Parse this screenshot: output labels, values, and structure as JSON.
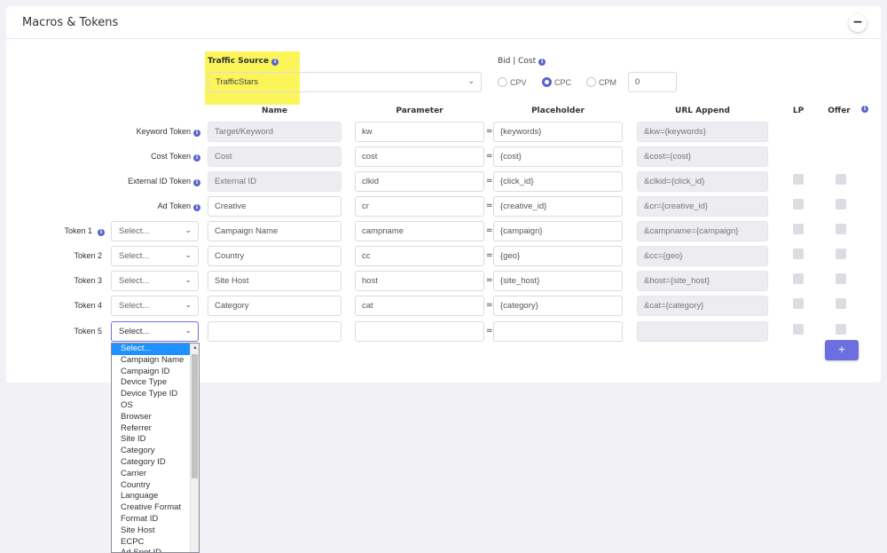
{
  "panel": {
    "title": "Macros & Tokens",
    "collapse_label": "−"
  },
  "traffic_source": {
    "label": "Traffic Source",
    "value": "TrafficStars"
  },
  "bid": {
    "label": "Bid | Cost",
    "options": [
      "CPV",
      "CPC",
      "CPM"
    ],
    "selected": "CPC",
    "amount": "0"
  },
  "columns": {
    "name": "Name",
    "parameter": "Parameter",
    "placeholder": "Placeholder",
    "url_append": "URL Append",
    "lp": "LP",
    "offer": "Offer"
  },
  "fixed_rows": [
    {
      "label": "Keyword Token",
      "name": "Target/Keyword",
      "parameter": "kw",
      "placeholder": "{keywords}",
      "append": "&kw={keywords}",
      "checks": false
    },
    {
      "label": "Cost Token",
      "name": "Cost",
      "parameter": "cost",
      "placeholder": "{cost}",
      "append": "&cost={cost}",
      "checks": false
    },
    {
      "label": "External ID Token",
      "name": "External ID",
      "parameter": "clkid",
      "placeholder": "{click_id}",
      "append": "&clkid={click_id}",
      "checks": true
    },
    {
      "label": "Ad Token",
      "name": "Creative",
      "parameter": "cr",
      "placeholder": "{creative_id}",
      "append": "&cr={creative_id}",
      "checks": true
    }
  ],
  "custom_rows": [
    {
      "label": "Token 1",
      "select": "Select...",
      "name": "Campaign Name",
      "parameter": "campname",
      "placeholder": "{campaign}",
      "append": "&campname={campaign}"
    },
    {
      "label": "Token 2",
      "select": "Select...",
      "name": "Country",
      "parameter": "cc",
      "placeholder": "{geo}",
      "append": "&cc={geo}"
    },
    {
      "label": "Token 3",
      "select": "Select...",
      "name": "Site Host",
      "parameter": "host",
      "placeholder": "{site_host}",
      "append": "&host={site_host}"
    },
    {
      "label": "Token 4",
      "select": "Select...",
      "name": "Category",
      "parameter": "cat",
      "placeholder": "{category}",
      "append": "&cat={category}"
    },
    {
      "label": "Token 5",
      "select": "Select...",
      "name": "",
      "parameter": "",
      "placeholder": "",
      "append": ""
    }
  ],
  "equals": "=",
  "add_button": "+",
  "dropdown_options": [
    "Select...",
    "Campaign Name",
    "Campaign ID",
    "Device Type",
    "Device Type ID",
    "OS",
    "Browser",
    "Referrer",
    "Site ID",
    "Category",
    "Category ID",
    "Carrier",
    "Country",
    "Language",
    "Creative Format",
    "Format ID",
    "Site Host",
    "ECPC",
    "Ad Spot ID"
  ],
  "colors": {
    "accent": "#5b64c9",
    "highlight": "#fbf55a",
    "selected_option": "#1e90ff"
  }
}
